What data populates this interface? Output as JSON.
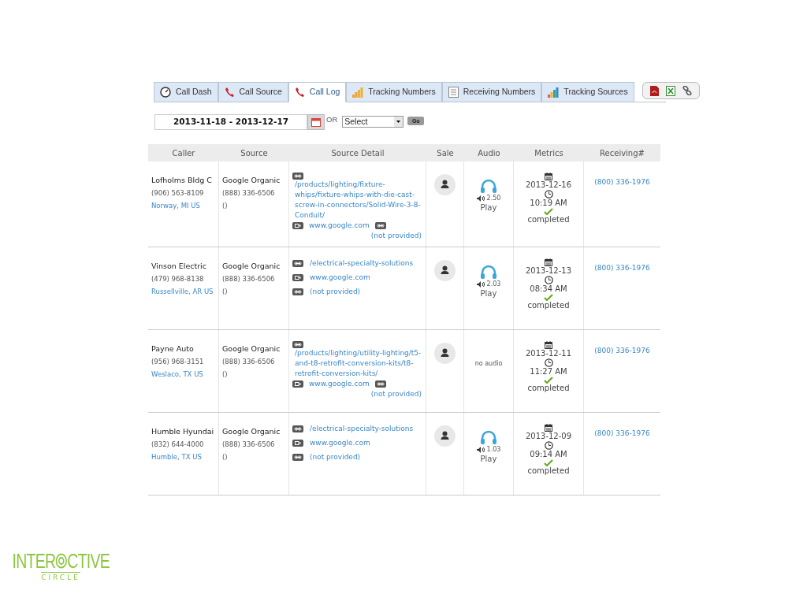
{
  "tabs": [
    {
      "label": "Call Dash",
      "selected": false
    },
    {
      "label": "Call Source",
      "selected": false
    },
    {
      "label": "Call Log",
      "selected": true
    },
    {
      "label": "Tracking Numbers",
      "selected": false
    },
    {
      "label": "Receiving Numbers",
      "selected": false
    },
    {
      "label": "Tracking Sources",
      "selected": false
    }
  ],
  "filter": {
    "date_range": "2013-11-18 - 2013-12-17",
    "or_label": "OR",
    "select": "Select",
    "go": "Go"
  },
  "table": {
    "columns": [
      "Caller",
      "Source",
      "Source Detail",
      "Sale",
      "Audio",
      "Metrics",
      "Receiving#"
    ],
    "rows": [
      {
        "caller": "Lofholms Bldg C",
        "phone": "(906) 563-8109",
        "location": "Norway, MI US",
        "source": "Google Organic",
        "source_phone": "(888) 336-6506",
        "source_extra": "()",
        "kind": "stacked",
        "detail": [
          {
            "kind": "link",
            "text": "/products/lighting/fixture-whips/fixture-whips-with-die-cast-screw-in-connectors/Solid-Wire-3-8-Conduit/"
          },
          {
            "kind": "referrer",
            "text": "www.google.com"
          },
          {
            "kind": "link",
            "text": "(not provided)"
          }
        ],
        "audio": {
          "kind": "play",
          "duration": "2.50",
          "label": "Play"
        },
        "date": "2013-12-16",
        "time": "10:19 AM",
        "status": "completed",
        "receiving": "(800) 336-1976"
      },
      {
        "caller": "Vinson Electric",
        "phone": "(479) 968-8138",
        "location": "Russellville, AR US",
        "source": "Google Organic",
        "source_phone": "(888) 336-6506",
        "source_extra": "()",
        "kind": "inline",
        "detail": [
          {
            "kind": "link",
            "text": "/electrical-specialty-solutions"
          },
          {
            "kind": "referrer",
            "text": "www.google.com"
          },
          {
            "kind": "link",
            "text": "(not provided)"
          }
        ],
        "audio": {
          "kind": "play",
          "duration": "2.03",
          "label": "Play"
        },
        "date": "2013-12-13",
        "time": "08:34 AM",
        "status": "completed",
        "receiving": "(800) 336-1976"
      },
      {
        "caller": "Payne Auto",
        "phone": "(956) 968-3151",
        "location": "Weslaco, TX US",
        "source": "Google Organic",
        "source_phone": "(888) 336-6506",
        "source_extra": "()",
        "kind": "stacked",
        "detail": [
          {
            "kind": "link",
            "text": "/products/lighting/utility-lighting/t5-and-t8-retrofit-conversion-kits/t8-retrofit-conversion-kits/"
          },
          {
            "kind": "referrer",
            "text": "www.google.com"
          },
          {
            "kind": "link",
            "text": "(not provided)"
          }
        ],
        "audio": {
          "kind": "none",
          "label": "no audio"
        },
        "date": "2013-12-11",
        "time": "11:27 AM",
        "status": "completed",
        "receiving": "(800) 336-1976"
      },
      {
        "caller": "Humble Hyundai",
        "phone": "(832) 644-4000",
        "location": "Humble, TX US",
        "source": "Google Organic",
        "source_phone": "(888) 336-6506",
        "source_extra": "()",
        "kind": "inline",
        "detail": [
          {
            "kind": "link",
            "text": "/electrical-specialty-solutions"
          },
          {
            "kind": "referrer",
            "text": "www.google.com"
          },
          {
            "kind": "link",
            "text": "(not provided)"
          }
        ],
        "audio": {
          "kind": "play",
          "duration": "1.03",
          "label": "Play"
        },
        "date": "2013-12-09",
        "time": "09:14 AM",
        "status": "completed",
        "receiving": "(800) 336-1976"
      }
    ]
  },
  "logo": {
    "left": "INTER",
    "right": "CTIVE",
    "sub": "CIRCLE"
  }
}
